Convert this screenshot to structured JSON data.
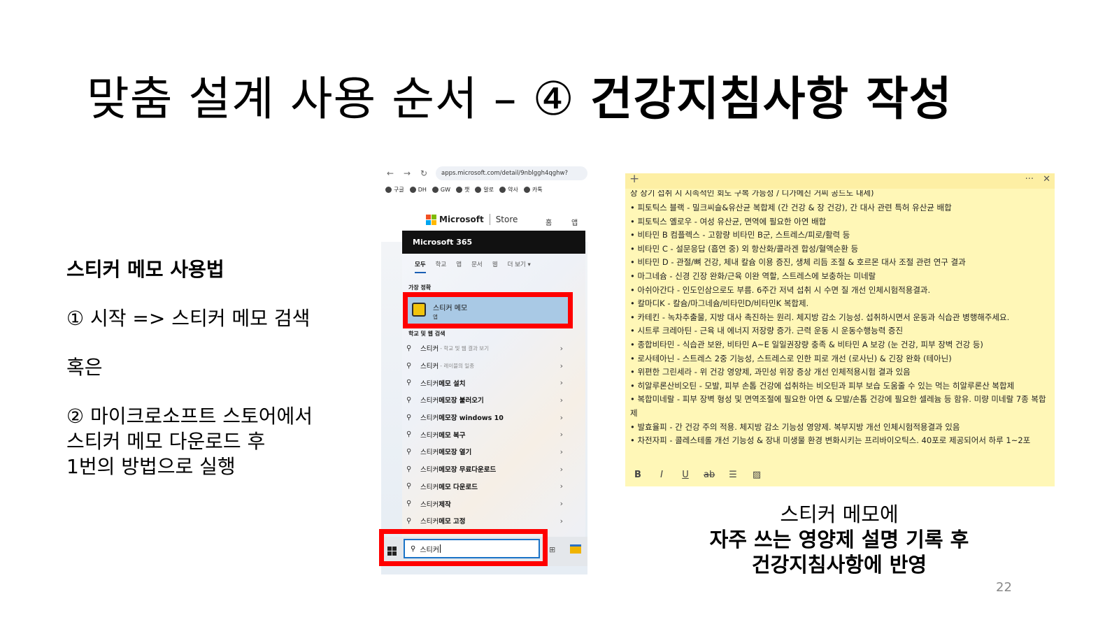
{
  "title": {
    "regular": "맞춤 설계 사용 순서 – ④ ",
    "bold": "건강지침사항 작성"
  },
  "howto": {
    "heading": "스티커 메모 사용법",
    "step1": "① 시작 => 스티커 메모 검색",
    "or": "혹은",
    "step2_l1": "② 마이크로소프트 스토어에서",
    "step2_l2": "스티커 메모 다운로드 후",
    "step2_l3": "1번의 방법으로 실행"
  },
  "browser": {
    "back": "←",
    "forward": "→",
    "reload": "↻",
    "url": "apps.microsoft.com/detail/9nblggh4qghw?",
    "bookmarks": [
      "구글",
      "DH",
      "GW",
      "챗",
      "알로",
      "약사",
      "카톡"
    ],
    "store": {
      "microsoft": "Microsoft",
      "store": "Store",
      "tab_home": "홈",
      "tab_apps": "앱"
    }
  },
  "startmenu": {
    "banner": "Microsoft 365",
    "tabs": [
      "모두",
      "학교",
      "앱",
      "문서",
      "웹",
      "더 보기 ▾"
    ],
    "best_match_label": "가장 정확",
    "best_match_name": "스티커 메모",
    "best_match_type": "앱",
    "web_label": "학교 및 웹 검색",
    "results": [
      {
        "typed": "스티커",
        "rest": "",
        "sub": "- 학교 및 웹 결과 보기"
      },
      {
        "typed": "스티커",
        "rest": "",
        "sub": "- 레이블의 일종"
      },
      {
        "typed": "스티커",
        "rest": "메모 설치",
        "sub": ""
      },
      {
        "typed": "스티커",
        "rest": "메모장 불러오기",
        "sub": ""
      },
      {
        "typed": "스티커",
        "rest": " 메모장 windows 10",
        "sub": ""
      },
      {
        "typed": "스티커",
        "rest": "메모 복구",
        "sub": ""
      },
      {
        "typed": "스티커",
        "rest": "메모장 열기",
        "sub": ""
      },
      {
        "typed": "스티커",
        "rest": "메모장 무료다운로드",
        "sub": ""
      },
      {
        "typed": "스티커",
        "rest": " 메모 다운로드",
        "sub": ""
      },
      {
        "typed": "스티커",
        "rest": "제작",
        "sub": ""
      },
      {
        "typed": "스티커",
        "rest": "메모 고정",
        "sub": ""
      }
    ],
    "search_value": "스티커"
  },
  "note": {
    "plus": "+",
    "more": "···",
    "close": "✕",
    "cut_line": "장 장기 섭취 시 시속적인 회도 구복 가능성 / 디가메진 거씨 공드도 내세)",
    "lines": [
      "• 피토틱스 블랙 - 밀크씨슬&유산균 복합제 (간 건강 & 장 건강), 간 대사 관련 특허 유산균 배합",
      "• 피토틱스 옐로우 - 여성 유산균, 면역에 필요한 아연 배합",
      "• 비타민 B 컴플렉스 - 고함량 비타민 B군, 스트레스/피로/활력 등",
      "• 비타민 C - 설문응답 (흡연 중) 외 항산화/콜라겐 합성/혈액순환 등",
      "• 비타민 D - 관절/뼈 건강, 체내 칼슘 이용 증진, 생체 리듬 조절 & 호르몬 대사 조절 관련 연구 결과",
      "• 마그네슘 - 신경 긴장 완화/근육 이완 역할, 스트레스에 보충하는 미네랄",
      "• 아쉬아간다 - 인도인삼으로도 부름. 6주간 저녁 섭취 시 수면 질 개선 인체시험적용결과.",
      "• 칼마디K - 칼슘/마그네슘/비타민D/비타민K 복합제.",
      "• 카테킨 - 녹차추출물, 지방 대사 촉진하는 원리. 체지방 감소 기능성. 섭취하시면서 운동과 식습관 병행해주세요.",
      "• 시트루 크레아틴 - 근육 내 에너지 저장량 증가. 근력 운동 시 운동수행능력 증진",
      "• 종합비타민 - 식습관 보완, 비타민 A~E 일일권장량 충족 & 비타민 A 보강 (눈 건강, 피부 장벽 건강 등)",
      "• 로사테아닌 - 스트레스 2중 기능성, 스트레스로 인한 피로 개선 (로사닌) & 긴장 완화 (테아닌)",
      "• 위편한 그린세라 - 위 건강 영양제, 과민성 위장 증상 개선 인체적용시험 결과 있음",
      "• 히알루론산비오틴 - 모발, 피부 손톱 건강에 섭취하는 비오틴과 피부 보습 도움줄 수 있는 먹는 히알루론산 복합제",
      "• 복합미네랄 - 피부 장벽 형성 및 면역조절에 필요한 아연 & 모발/손톱 건강에 필요한 셀레늄 등 함유. 미량 미네랄 7종 복합제",
      "• 발효율피 - 간 건강 주의 적용. 체지방 감소 기능성 영양제. 복부지방 개선 인체시험적용결과 있음",
      "• 차전자피 - 콜레스테롤 개선 기능성 & 장내 미생물 환경 변화시키는 프리바이오틱스. 40포로 제공되어서 하루 1~2포"
    ],
    "tools": [
      "B",
      "I",
      "U",
      "ab",
      "☰",
      "▨"
    ]
  },
  "caption": {
    "l1": "스티커 메모에",
    "l2": "자주 쓰는 영양제 설명 기록 후",
    "l3": "건강지침사항에 반영"
  },
  "page_number": "22",
  "colors": {
    "highlight_red": "#ff0000",
    "note_yellow": "#fff7b7",
    "selection_blue": "#a9c9e5"
  }
}
